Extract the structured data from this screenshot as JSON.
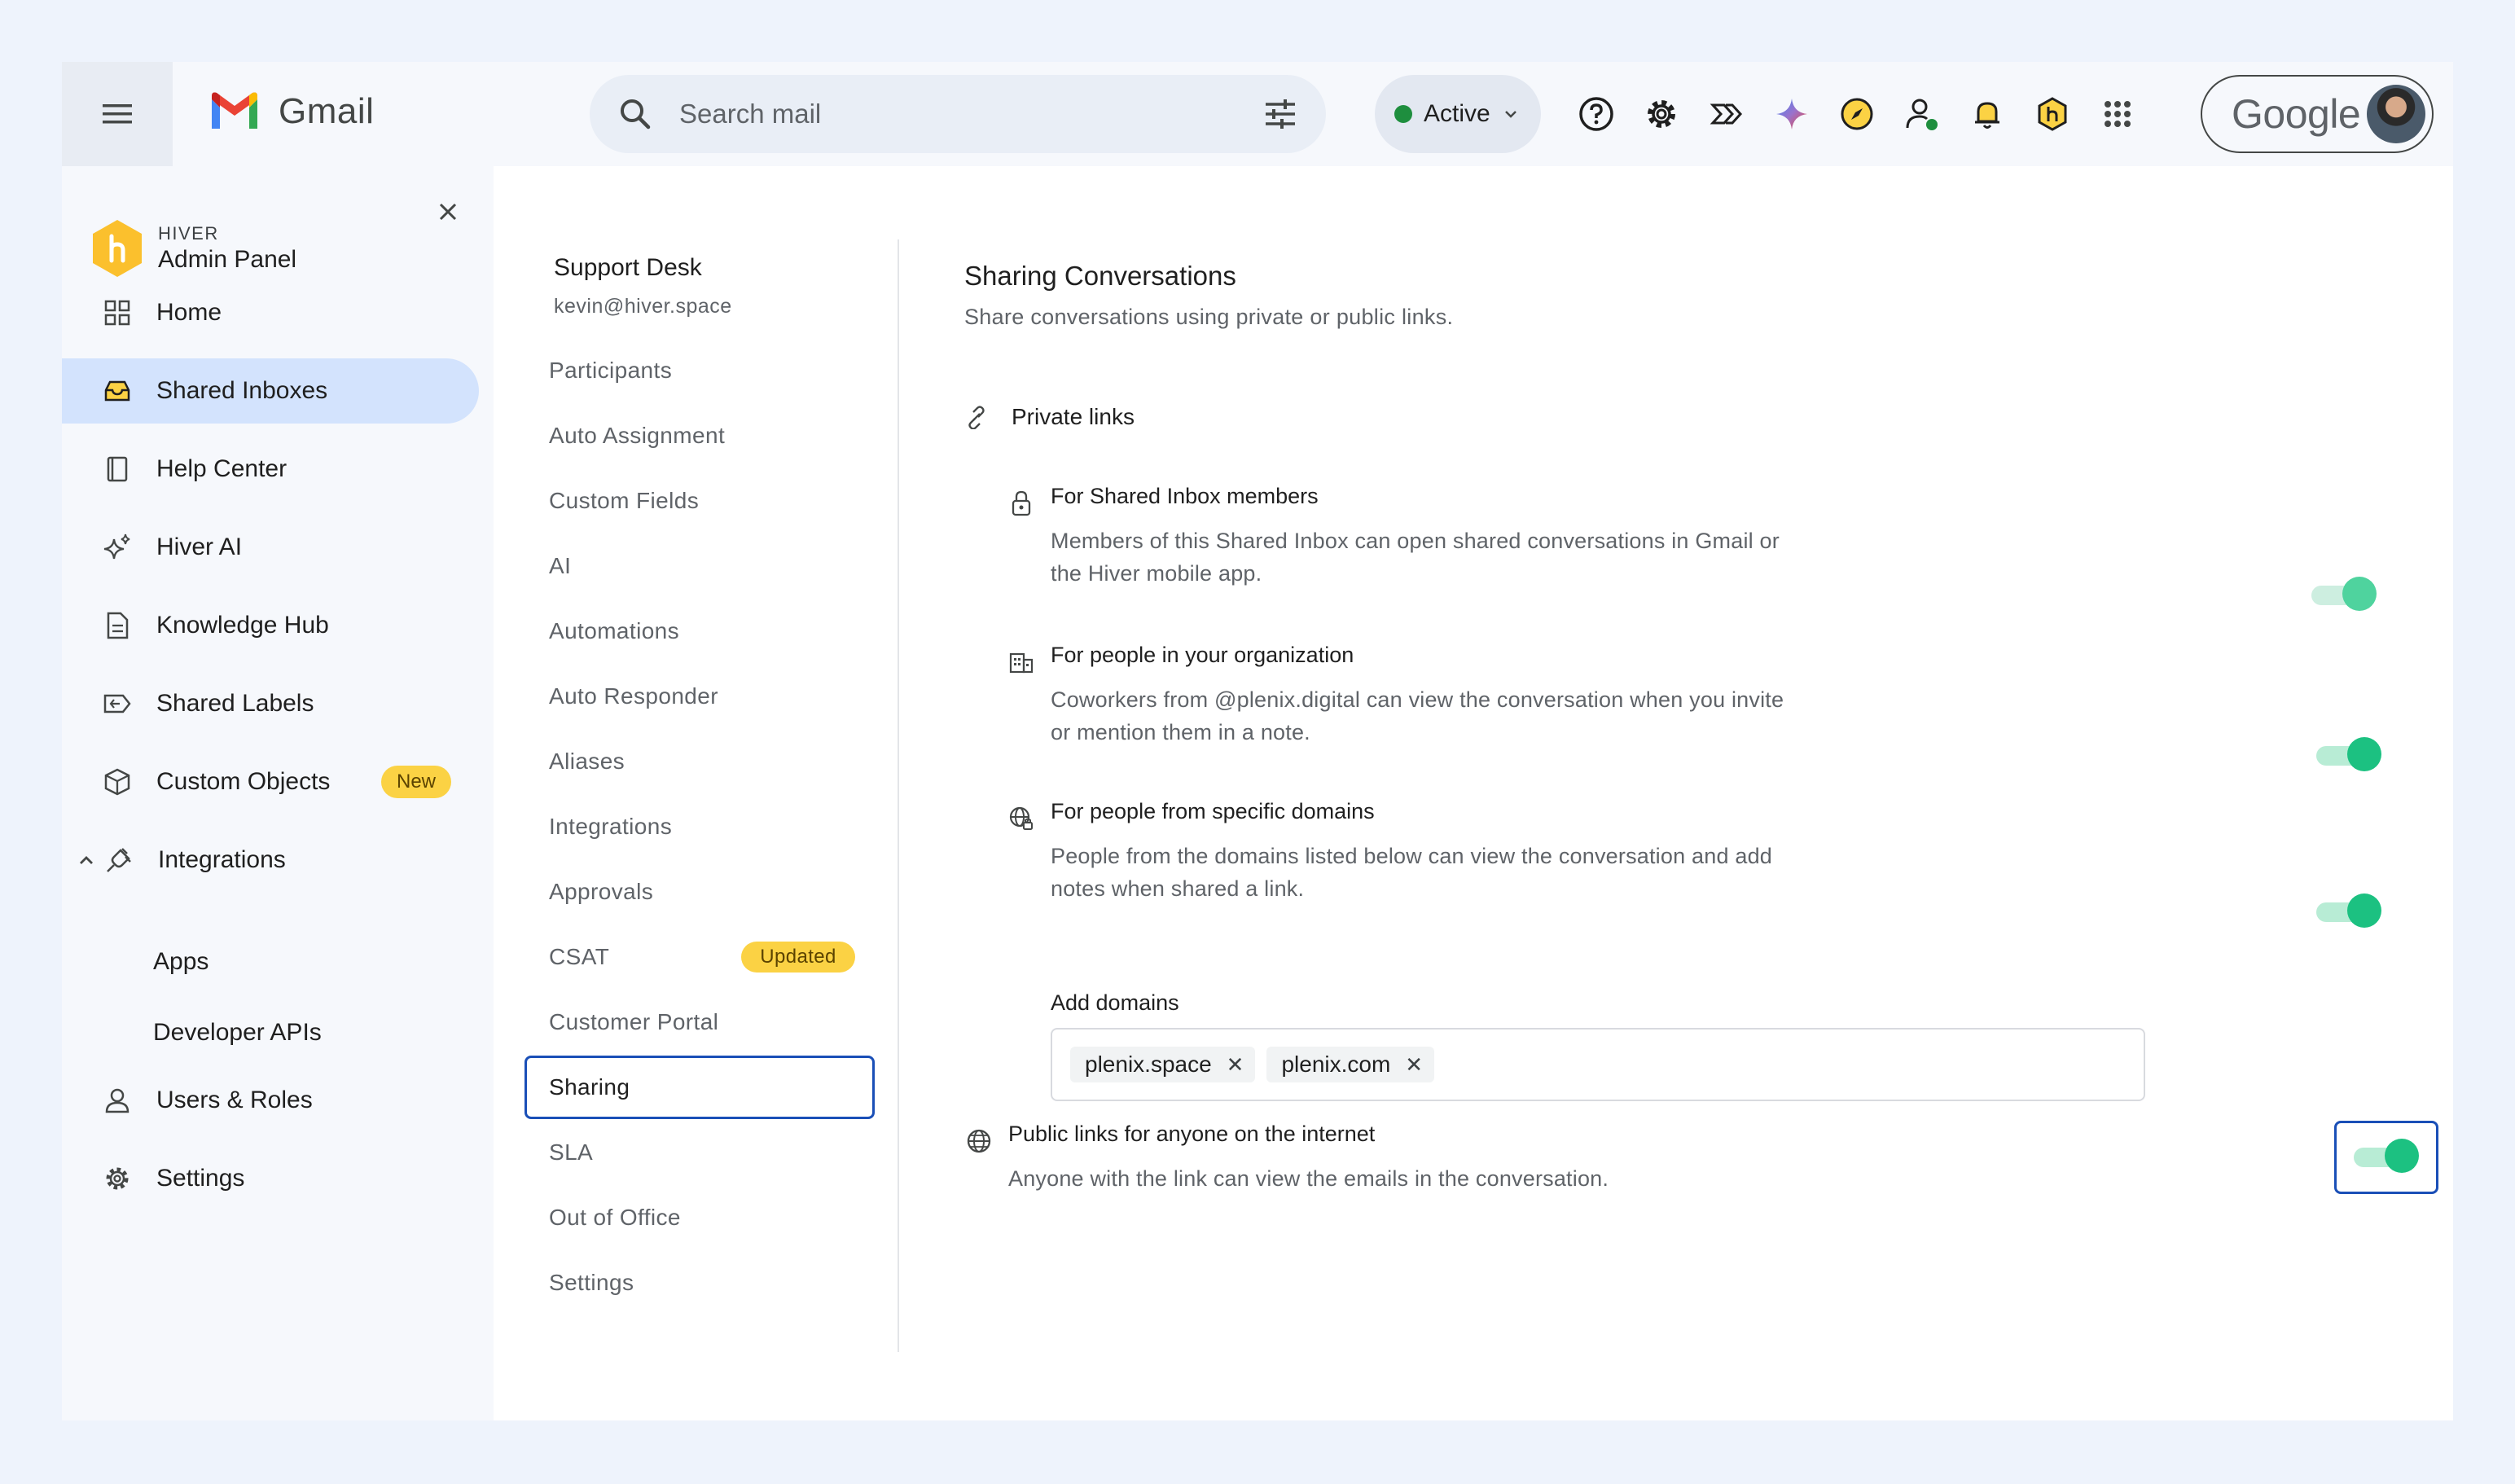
{
  "colors": {
    "accent_blue": "#1a4fb7",
    "toggle_green": "#1cc181",
    "badge_yellow": "#fbd244",
    "active_nav_bg": "#d3e3fd",
    "status_green": "#1e8e3e"
  },
  "topbar": {
    "app_name": "Gmail",
    "search": {
      "placeholder": "Search mail"
    },
    "status": {
      "label": "Active"
    },
    "icons": [
      "help-icon",
      "settings-icon",
      "hiver-icon",
      "gemini-icon",
      "compass-icon",
      "user-status-icon",
      "bell-icon",
      "hiver-hex-icon",
      "apps-grid-icon"
    ],
    "account_brand": "Google"
  },
  "sidebar": {
    "brand_small": "HIVER",
    "brand_title": "Admin Panel",
    "items": [
      {
        "label": "Home",
        "icon": "grid-icon",
        "active": false
      },
      {
        "label": "Shared Inboxes",
        "icon": "inbox-icon",
        "active": true
      },
      {
        "label": "Help Center",
        "icon": "book-icon",
        "active": false
      },
      {
        "label": "Hiver AI",
        "icon": "sparkle-icon",
        "active": false
      },
      {
        "label": "Knowledge Hub",
        "icon": "document-icon",
        "active": false
      },
      {
        "label": "Shared Labels",
        "icon": "label-icon",
        "active": false
      },
      {
        "label": "Custom Objects",
        "icon": "cube-icon",
        "active": false,
        "badge": "New"
      },
      {
        "label": "Integrations",
        "icon": "plug-icon",
        "active": false,
        "expanded": true
      },
      {
        "label": "Users & Roles",
        "icon": "user-icon",
        "active": false
      },
      {
        "label": "Settings",
        "icon": "gear-icon",
        "active": false
      }
    ],
    "integrations_children": [
      "Apps",
      "Developer APIs"
    ]
  },
  "subnav": {
    "inbox_name": "Support Desk",
    "inbox_email": "kevin@hiver.space",
    "items": [
      {
        "label": "Participants"
      },
      {
        "label": "Auto Assignment"
      },
      {
        "label": "Custom Fields"
      },
      {
        "label": "AI"
      },
      {
        "label": "Automations"
      },
      {
        "label": "Auto Responder"
      },
      {
        "label": "Aliases"
      },
      {
        "label": "Integrations"
      },
      {
        "label": "Approvals"
      },
      {
        "label": "CSAT",
        "badge": "Updated"
      },
      {
        "label": "Customer Portal"
      },
      {
        "label": "Sharing",
        "active": true
      },
      {
        "label": "SLA"
      },
      {
        "label": "Out of Office"
      },
      {
        "label": "Settings"
      }
    ]
  },
  "main": {
    "title": "Sharing Conversations",
    "subtitle": "Share conversations using private or public links.",
    "private_links": {
      "heading": "Private links",
      "options": [
        {
          "title": "For Shared Inbox members",
          "description": "Members of this Shared Inbox can open shared conversations in Gmail or the Hiver mobile app.",
          "enabled": true
        },
        {
          "title": "For people in your organization",
          "description": "Coworkers from @plenix.digital can view the conversation when you invite or mention them in a note.",
          "enabled": true
        },
        {
          "title": "For people from specific domains",
          "description": "People from the domains listed below can view the conversation and add notes when shared a link.",
          "enabled": true
        }
      ],
      "domains_label": "Add domains",
      "domains": [
        "plenix.space",
        "plenix.com"
      ]
    },
    "public_links": {
      "title": "Public links for anyone on the internet",
      "description": "Anyone with the link can view the emails in the conversation.",
      "enabled": true
    }
  }
}
